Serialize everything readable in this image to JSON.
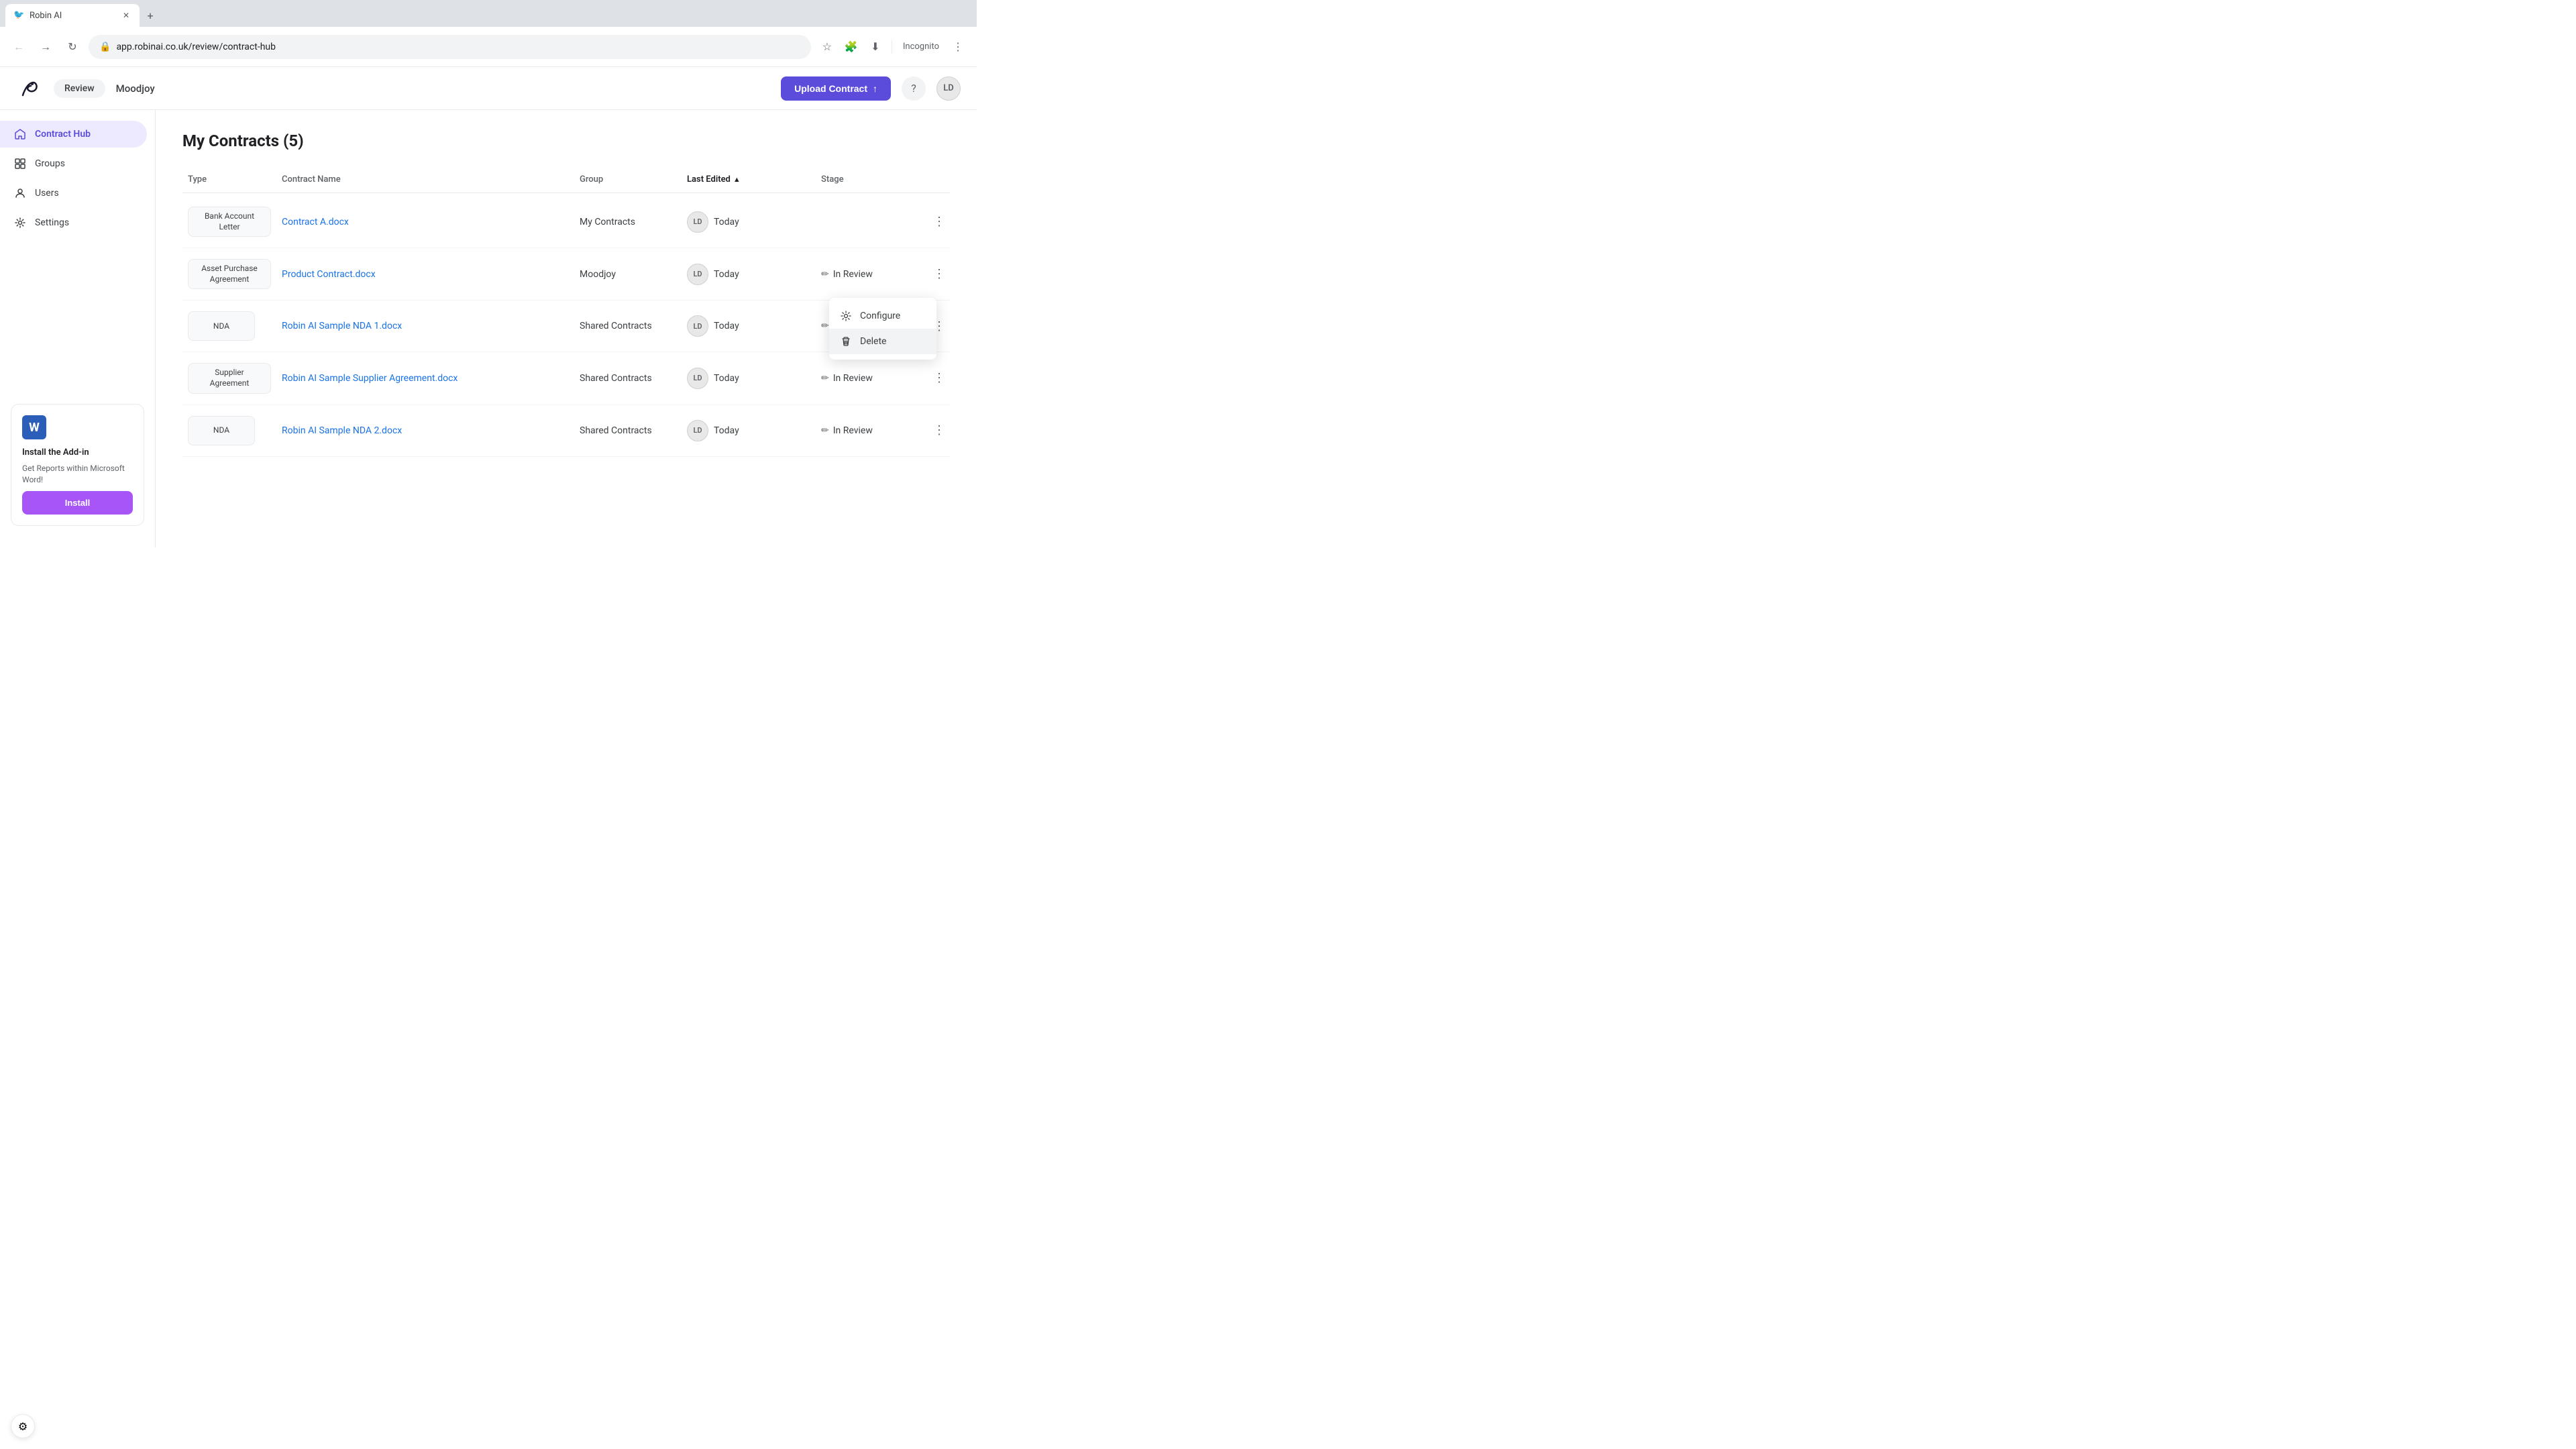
{
  "browser": {
    "tab_title": "Robin AI",
    "tab_favicon": "🐦",
    "url": "app.robinai.co.uk/review/contract-hub",
    "new_tab_label": "+",
    "incognito_label": "Incognito"
  },
  "header": {
    "nav_pill": "Review",
    "workspace": "Moodjoy",
    "upload_button": "Upload Contract",
    "help_icon": "?",
    "avatar": "LD"
  },
  "sidebar": {
    "items": [
      {
        "id": "contract-hub",
        "label": "Contract Hub",
        "active": true
      },
      {
        "id": "groups",
        "label": "Groups",
        "active": false
      },
      {
        "id": "users",
        "label": "Users",
        "active": false
      },
      {
        "id": "settings",
        "label": "Settings",
        "active": false
      }
    ],
    "addon": {
      "icon_letter": "W",
      "title": "Install the Add-in",
      "description": "Get Reports within Microsoft Word!",
      "install_button": "Install"
    }
  },
  "main": {
    "page_title": "My Contracts (5)",
    "table": {
      "columns": [
        "Type",
        "Contract Name",
        "Group",
        "Last Edited",
        "Stage",
        ""
      ],
      "rows": [
        {
          "type": "Bank Account Letter",
          "contract_name": "Contract A.docx",
          "group": "My Contracts",
          "avatar": "LD",
          "last_edited": "Today",
          "stage": "",
          "has_context_menu": true
        },
        {
          "type": "Asset Purchase Agreement",
          "contract_name": "Product Contract.docx",
          "group": "Moodjoy",
          "avatar": "LD",
          "last_edited": "Today",
          "stage": "In Review",
          "has_context_menu": false
        },
        {
          "type": "NDA",
          "contract_name": "Robin AI Sample NDA 1.docx",
          "group": "Shared Contracts",
          "avatar": "LD",
          "last_edited": "Today",
          "stage": "In Review",
          "has_context_menu": false
        },
        {
          "type": "Supplier Agreement",
          "contract_name": "Robin AI Sample Supplier Agreement.docx",
          "group": "Shared Contracts",
          "avatar": "LD",
          "last_edited": "Today",
          "stage": "In Review",
          "has_context_menu": false
        },
        {
          "type": "NDA",
          "contract_name": "Robin AI Sample NDA 2.docx",
          "group": "Shared Contracts",
          "avatar": "LD",
          "last_edited": "Today",
          "stage": "In Review",
          "has_context_menu": false
        }
      ]
    }
  },
  "context_menu": {
    "items": [
      {
        "id": "configure",
        "label": "Configure"
      },
      {
        "id": "delete",
        "label": "Delete"
      }
    ]
  }
}
